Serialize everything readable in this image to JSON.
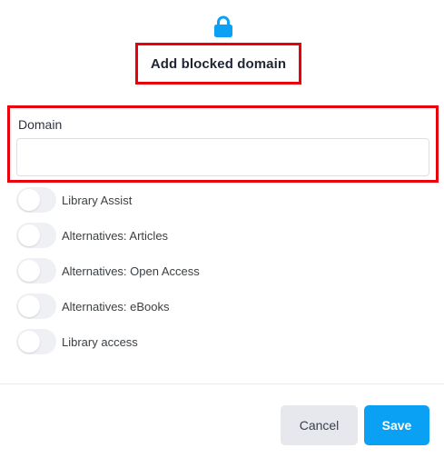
{
  "dialog": {
    "title": "Add blocked domain",
    "icon": "lock-icon",
    "accent_color": "#0aa1f5",
    "highlight_color": "#e8000b"
  },
  "domain": {
    "label": "Domain",
    "value": "",
    "placeholder": ""
  },
  "toggles": [
    {
      "label": "Library Assist",
      "enabled": false
    },
    {
      "label": "Alternatives: Articles",
      "enabled": false
    },
    {
      "label": "Alternatives: Open Access",
      "enabled": false
    },
    {
      "label": "Alternatives: eBooks",
      "enabled": false
    },
    {
      "label": "Library access",
      "enabled": false
    }
  ],
  "footer": {
    "cancel_label": "Cancel",
    "save_label": "Save"
  }
}
